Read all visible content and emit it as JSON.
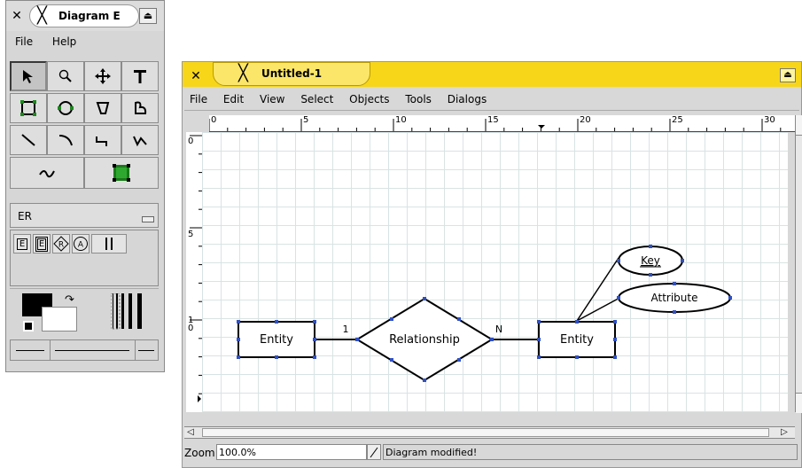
{
  "toolbox": {
    "title": "Diagram E",
    "menu": [
      "File",
      "Help"
    ],
    "sheet_selector": "ER",
    "sheet_tools": [
      "E",
      "E",
      "R",
      "A"
    ]
  },
  "diagram_window": {
    "title": "Untitled-1",
    "menu": [
      "File",
      "Edit",
      "View",
      "Select",
      "Objects",
      "Tools",
      "Dialogs"
    ],
    "ruler_top": [
      "0",
      "5",
      "10",
      "15",
      "20",
      "25",
      "30"
    ],
    "ruler_left": [
      "0",
      "5",
      "1",
      "0"
    ],
    "zoom_label": "Zoom",
    "zoom_value": "100.0%",
    "status": "Diagram modified!"
  },
  "diagram": {
    "entity_left": "Entity",
    "relationship": "Relationship",
    "entity_right": "Entity",
    "card_left": "1",
    "card_right": "N",
    "key_attr": "Key",
    "attr": "Attribute"
  },
  "colors": {
    "titlebar_active": "#f7d61a",
    "handle": "#3050c0"
  }
}
